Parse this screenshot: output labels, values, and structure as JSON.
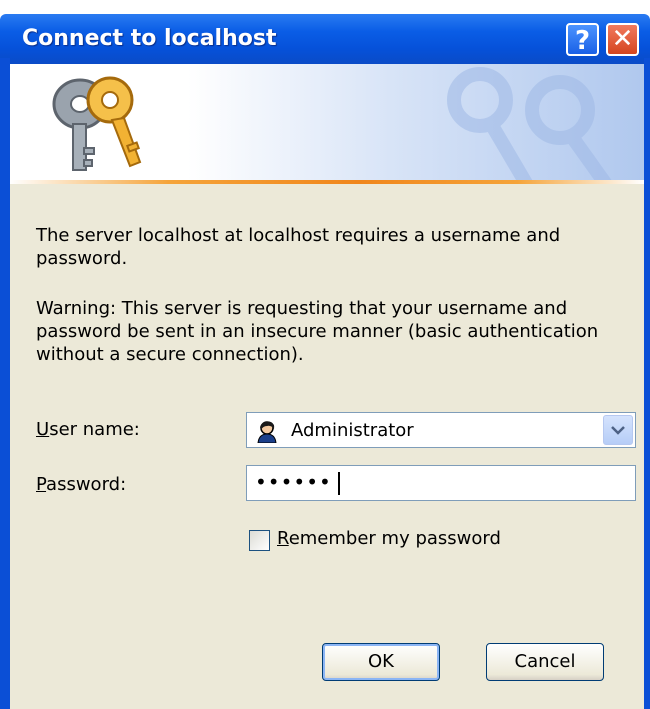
{
  "window": {
    "title": "Connect to localhost",
    "help_glyph": "?",
    "close_glyph": "✕"
  },
  "banner": {
    "icon": "keys-icon",
    "accent_color": "#f0861c"
  },
  "message": {
    "line1": "The server localhost at localhost requires a username and password.",
    "warning": "Warning: This server is requesting that your username and password be sent in an insecure manner (basic authentication without a secure connection)."
  },
  "form": {
    "username_label_u": "U",
    "username_label_rest": "ser name:",
    "username_value": "Administrator",
    "username_icon": "user-icon",
    "password_label_u": "P",
    "password_label_rest": "assword:",
    "password_mask": "••••••",
    "remember_u": "R",
    "remember_rest": "emember my password",
    "remember_checked": false
  },
  "buttons": {
    "ok": "OK",
    "cancel": "Cancel"
  },
  "colors": {
    "titlebar": "#0a5de6",
    "dialog_bg": "#ece9d8",
    "close": "#d5451f"
  }
}
